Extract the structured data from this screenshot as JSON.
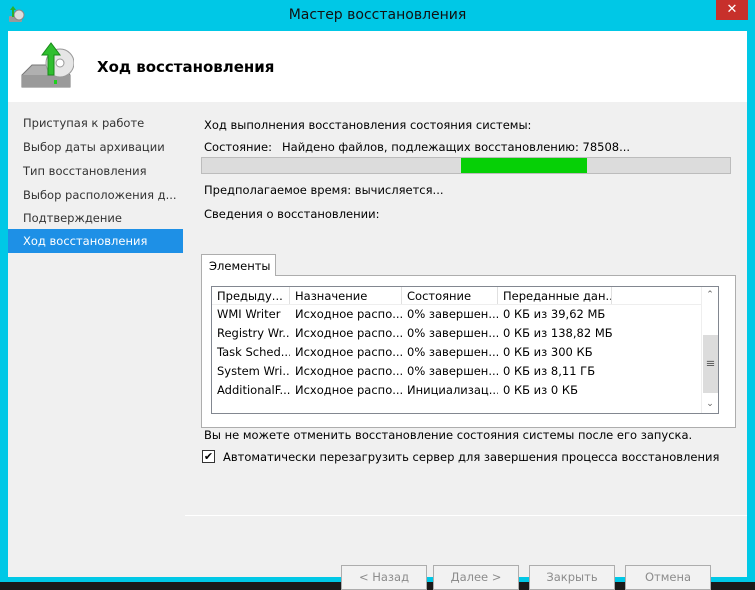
{
  "window": {
    "title": "Мастер восстановления",
    "close_glyph": "✕"
  },
  "header": {
    "title": "Ход восстановления"
  },
  "sidebar": {
    "items": [
      {
        "label": "Приступая к работе"
      },
      {
        "label": "Выбор даты архивации"
      },
      {
        "label": "Тип восстановления"
      },
      {
        "label": "Выбор расположения д..."
      },
      {
        "label": "Подтверждение"
      },
      {
        "label": "Ход восстановления",
        "active": true
      }
    ]
  },
  "main": {
    "progress_heading": "Ход выполнения восстановления состояния системы:",
    "status_label": "Состояние:",
    "status_value": "Найдено файлов, подлежащих восстановлению: 78508...",
    "progress": {
      "indeterminate": true,
      "segment_start_pct": 49,
      "segment_end_pct": 73,
      "color": "#06d006"
    },
    "estimated_time": "Предполагаемое время: вычисляется...",
    "details_heading": "Сведения о восстановлении:",
    "tab": "Элементы",
    "columns": [
      "Предыду...",
      "Назначение",
      "Состояние",
      "Переданные дан..."
    ],
    "rows": [
      [
        "WMI Writer",
        "Исходное распо...",
        "0% завершен...",
        "0 КБ из 39,62 МБ"
      ],
      [
        "Registry Wr...",
        "Исходное распо...",
        "0% завершен...",
        "0 КБ из 138,82 МБ"
      ],
      [
        "Task Sched...",
        "Исходное распо...",
        "0% завершен...",
        "0 КБ из 300 КБ"
      ],
      [
        "System Wri...",
        "Исходное распо...",
        "0% завершен...",
        "0 КБ из 8,11 ГБ"
      ],
      [
        "AdditionalF...",
        "Исходное распо...",
        "Инициализац...",
        "0 КБ из 0 КБ"
      ]
    ],
    "warning": "Вы не можете отменить восстановление состояния системы после его запуска.",
    "auto_restart": {
      "label": "Автоматически перезагрузить сервер для завершения процесса восстановления",
      "checked": true
    }
  },
  "buttons": {
    "back": "< Назад",
    "next": "Далее >",
    "close": "Закрыть",
    "cancel": "Отмена"
  }
}
